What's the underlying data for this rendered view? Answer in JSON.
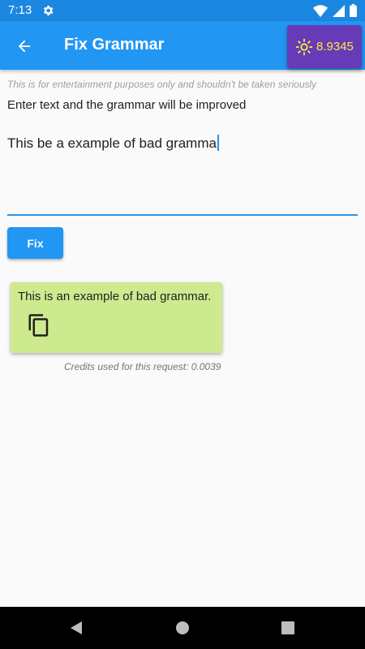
{
  "status_bar": {
    "time": "7:13",
    "icons": [
      "gear-icon",
      "wifi-icon",
      "signal-icon",
      "battery-icon"
    ]
  },
  "app_bar": {
    "title": "Fix Grammar",
    "back_icon": "arrow-back-icon",
    "credits_icon": "sun-icon",
    "credits": "8.9345"
  },
  "main": {
    "disclaimer": "This is for entertainment purposes only and shouldn't be taken seriously",
    "instruction": "Enter text and the grammar will be improved",
    "input_value": "This be a example of bad gramma",
    "fix_label": "Fix",
    "result_text": "This is an example of bad grammar.",
    "copy_icon": "copy-icon",
    "credits_used": "Credits used for this request: 0.0039"
  },
  "nav_bar": {
    "icons": [
      "back-triangle-icon",
      "home-circle-icon",
      "recents-square-icon"
    ]
  },
  "colors": {
    "primary": "#2196f3",
    "status_bar": "#1b87e0",
    "credits_chip": "#673ab7",
    "credits_text": "#ffeb3b",
    "result_card": "#cdea8f"
  }
}
